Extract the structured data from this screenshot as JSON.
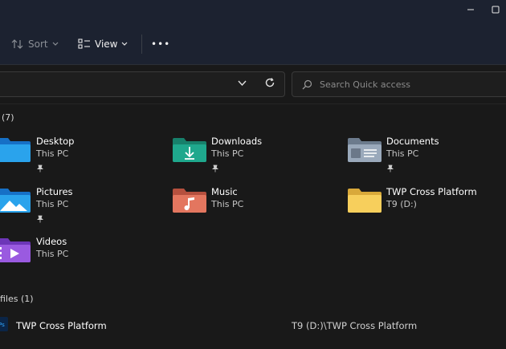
{
  "toolbar": {
    "sort_label": "Sort",
    "view_label": "View",
    "more_label": "•••"
  },
  "search": {
    "placeholder": "Search Quick access"
  },
  "quick_access": {
    "header": "(7)",
    "items": [
      {
        "name": "Desktop",
        "location": "This PC",
        "pinned": true,
        "icon": "desktop-folder-icon"
      },
      {
        "name": "Downloads",
        "location": "This PC",
        "pinned": true,
        "icon": "downloads-folder-icon"
      },
      {
        "name": "Documents",
        "location": "This PC",
        "pinned": true,
        "icon": "documents-folder-icon"
      },
      {
        "name": "Pictures",
        "location": "This PC",
        "pinned": true,
        "icon": "pictures-folder-icon"
      },
      {
        "name": "Music",
        "location": "This PC",
        "pinned": false,
        "icon": "music-folder-icon"
      },
      {
        "name": "TWP Cross Platform",
        "location": "T9 (D:)",
        "pinned": false,
        "icon": "yellow-folder-icon"
      },
      {
        "name": "Videos",
        "location": "This PC",
        "pinned": false,
        "icon": "videos-folder-icon"
      }
    ]
  },
  "recent_files": {
    "header": "files (1)",
    "items": [
      {
        "name": "TWP Cross Platform",
        "path": "T9 (D:)\\TWP Cross Platform"
      }
    ]
  }
}
